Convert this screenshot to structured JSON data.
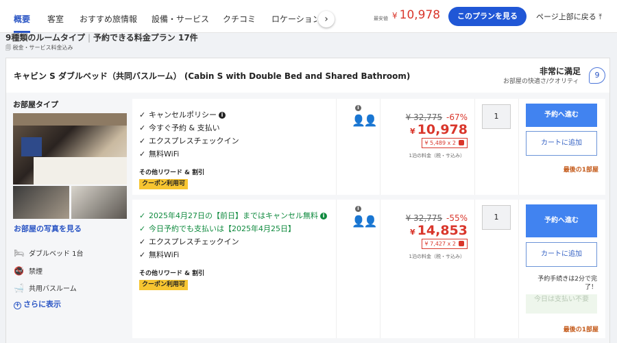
{
  "nav": {
    "tabs": [
      "概要",
      "客室",
      "おすすめ旅情報",
      "設備・サービス",
      "クチコミ",
      "ロケーション"
    ],
    "min_price_label": "最安値",
    "min_price_currency": "¥",
    "min_price": "10,978",
    "plan_button": "このプランを見る",
    "page_top": "ページ上部に戻る"
  },
  "summary": {
    "room_types": "9種類のルームタイプ",
    "plans": "予約できる料金プラン 17件",
    "tax_note": "税金・サービス料金込み"
  },
  "room": {
    "title": "キャビン S ダブルベッド（共同バスルーム） (Cabin S with Double Bed and Shared Bathroom)",
    "rating_label": "非常に満足",
    "rating_sub": "お部屋の快適さ/クオリティ",
    "rating_score": "9",
    "type_heading": "お部屋タイプ",
    "photos_link": "お部屋の写真を見る",
    "features": [
      "ダブルベッド 1台",
      "禁煙",
      "共用バスルーム"
    ],
    "more_link": "さらに表示"
  },
  "plans": [
    {
      "conditions": [
        {
          "text": "キャンセルポリシー",
          "green": false,
          "info": true
        },
        {
          "text": "今すぐ予約 & 支払い",
          "green": false,
          "info": false
        },
        {
          "text": "エクスプレスチェックイン",
          "green": false,
          "info": false
        },
        {
          "text": "無料WiFi",
          "green": false,
          "info": false
        }
      ],
      "reward_label": "その他リワード & 割引",
      "coupon": "クーポン利用可",
      "original_price": "¥ 32,775",
      "discount": "-67%",
      "currency": "¥",
      "price": "10,978",
      "per_person": "¥ 5,489 x 2",
      "price_note": "1泊の料金（税・サ込み）",
      "qty": "1",
      "reserve_label": "予約へ進む",
      "cart_label": "カートに追加",
      "last_room": "最後の1部屋"
    },
    {
      "conditions": [
        {
          "text": "2025年4月27日の【前日】まではキャンセル無料",
          "green": true,
          "info": true
        },
        {
          "text": "今日予約でも支払いは【2025年4月25日】",
          "green": true,
          "info": false
        },
        {
          "text": "エクスプレスチェックイン",
          "green": false,
          "info": false
        },
        {
          "text": "無料WiFi",
          "green": false,
          "info": false
        }
      ],
      "reward_label": "その他リワード & 割引",
      "coupon": "クーポン利用可",
      "original_price": "¥ 32,775",
      "discount": "-55%",
      "currency": "¥",
      "price": "14,853",
      "per_person": "¥ 7,427 x 2",
      "price_note": "1泊の料金（税・サ込み）",
      "qty": "1",
      "reserve_label": "予約へ進む",
      "cart_label": "カートに追加",
      "quick_note": "予約手続きは2分で完了！",
      "no_pay_note": "今日は支払い不要",
      "last_room": "最後の1部屋"
    }
  ],
  "icons": {
    "check": "check-icon",
    "info": "info-icon",
    "person": "person-icon",
    "bed": "bed-icon",
    "no_smoking": "no-smoking-icon",
    "bath": "bath-icon"
  },
  "colors": {
    "accent": "#2057d6",
    "price_red": "#d9362b",
    "green": "#0f8a3e",
    "coupon": "#f7c531"
  }
}
